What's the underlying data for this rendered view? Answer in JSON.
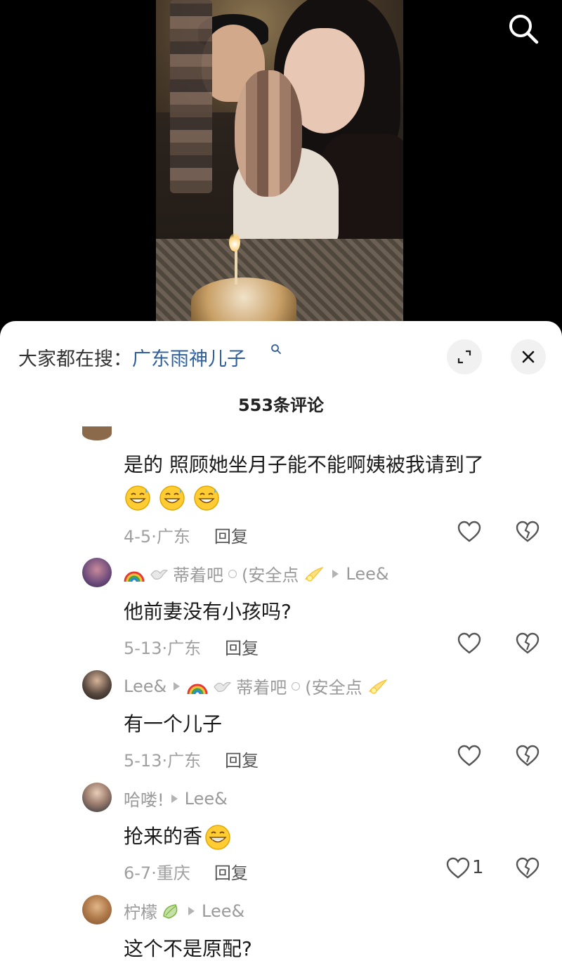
{
  "video": {
    "search_icon": "search-icon"
  },
  "sheet": {
    "search_prefix": "大家都在搜：",
    "search_term": "广东雨神儿子",
    "expand_icon": "expand-icon",
    "close_icon": "close-icon",
    "comment_count": "553条评论"
  },
  "comments": [
    {
      "text": "是的 照顾她坐月子能不能啊姨被我请到了",
      "emoji": "grin-sweat-emoji ×3",
      "date_region": "4-5·广东",
      "reply_label": "回复"
    },
    {
      "username": "蒂着吧",
      "username_suffix": "(安全点",
      "reply_to": "Lee&",
      "text": "他前妻没有小孩吗?",
      "date_region": "5-13·广东",
      "reply_label": "回复"
    },
    {
      "username": "Lee&",
      "reply_to_name": "蒂着吧",
      "reply_to_suffix": "(安全点",
      "text": "有一个儿子",
      "date_region": "5-13·广东",
      "reply_label": "回复"
    },
    {
      "username": "哈喽!",
      "reply_to": "Lee&",
      "text": "抢来的香",
      "date_region": "6-7·重庆",
      "reply_label": "回复",
      "like_count": "1"
    },
    {
      "username": "柠檬",
      "reply_to": "Lee&",
      "text": "这个不是原配?"
    }
  ],
  "colors": {
    "link_blue": "#2f5f9f",
    "meta_gray": "#a0a0a0",
    "sheet_bg": "#ffffff"
  }
}
